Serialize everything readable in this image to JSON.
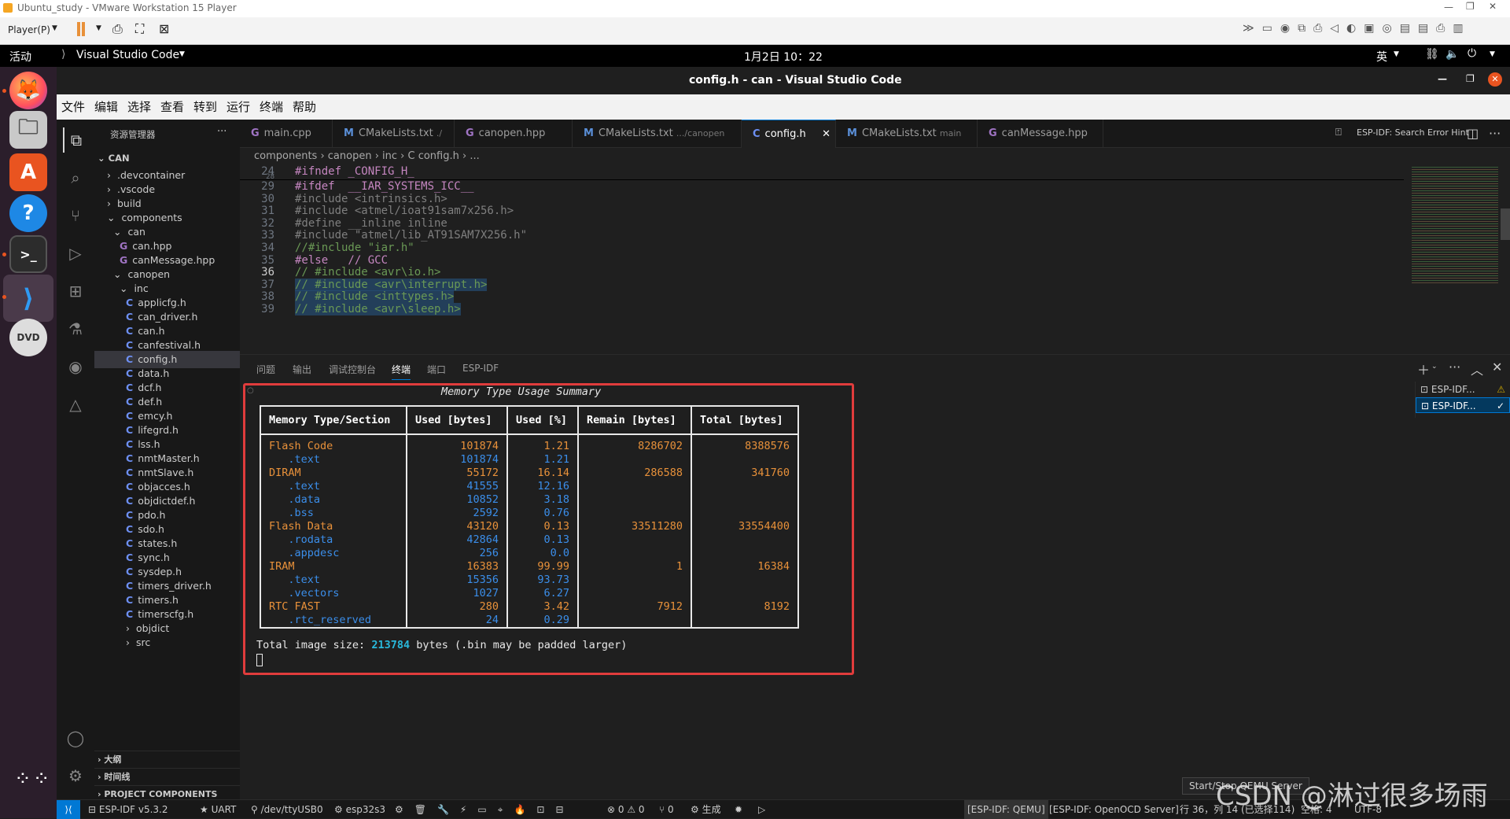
{
  "vm": {
    "title": "Ubuntu_study - VMware Workstation 15 Player",
    "player_menu": "Player(P)"
  },
  "ubuntu": {
    "activities": "活动",
    "app_menu": "Visual Studio Code",
    "clock": "1月2日  10：22",
    "input_method": "英"
  },
  "vscode": {
    "window_title": "config.h - can - Visual Studio Code",
    "menu": [
      "文件",
      "编辑",
      "选择",
      "查看",
      "转到",
      "运行",
      "终端",
      "帮助"
    ],
    "explorer_title": "资源管理器",
    "root": "CAN",
    "tree": [
      {
        "label": ".devcontainer",
        "type": "folder",
        "depth": 1,
        "open": false
      },
      {
        "label": ".vscode",
        "type": "folder",
        "depth": 1,
        "open": false
      },
      {
        "label": "build",
        "type": "folder",
        "depth": 1,
        "open": false
      },
      {
        "label": "components",
        "type": "folder",
        "depth": 1,
        "open": true
      },
      {
        "label": "can",
        "type": "folder",
        "depth": 2,
        "open": true
      },
      {
        "label": "can.hpp",
        "type": "cpp",
        "depth": 3
      },
      {
        "label": "canMessage.hpp",
        "type": "cpp",
        "depth": 3
      },
      {
        "label": "canopen",
        "type": "folder",
        "depth": 2,
        "open": true
      },
      {
        "label": "inc",
        "type": "folder",
        "depth": 3,
        "open": true
      },
      {
        "label": "applicfg.h",
        "type": "c",
        "depth": 4
      },
      {
        "label": "can_driver.h",
        "type": "c",
        "depth": 4
      },
      {
        "label": "can.h",
        "type": "c",
        "depth": 4
      },
      {
        "label": "canfestival.h",
        "type": "c",
        "depth": 4
      },
      {
        "label": "config.h",
        "type": "c",
        "depth": 4,
        "selected": true
      },
      {
        "label": "data.h",
        "type": "c",
        "depth": 4
      },
      {
        "label": "dcf.h",
        "type": "c",
        "depth": 4
      },
      {
        "label": "def.h",
        "type": "c",
        "depth": 4
      },
      {
        "label": "emcy.h",
        "type": "c",
        "depth": 4
      },
      {
        "label": "lifegrd.h",
        "type": "c",
        "depth": 4
      },
      {
        "label": "lss.h",
        "type": "c",
        "depth": 4
      },
      {
        "label": "nmtMaster.h",
        "type": "c",
        "depth": 4
      },
      {
        "label": "nmtSlave.h",
        "type": "c",
        "depth": 4
      },
      {
        "label": "objacces.h",
        "type": "c",
        "depth": 4
      },
      {
        "label": "objdictdef.h",
        "type": "c",
        "depth": 4
      },
      {
        "label": "pdo.h",
        "type": "c",
        "depth": 4
      },
      {
        "label": "sdo.h",
        "type": "c",
        "depth": 4
      },
      {
        "label": "states.h",
        "type": "c",
        "depth": 4
      },
      {
        "label": "sync.h",
        "type": "c",
        "depth": 4
      },
      {
        "label": "sysdep.h",
        "type": "c",
        "depth": 4
      },
      {
        "label": "timers_driver.h",
        "type": "c",
        "depth": 4
      },
      {
        "label": "timers.h",
        "type": "c",
        "depth": 4
      },
      {
        "label": "timerscfg.h",
        "type": "c",
        "depth": 4
      },
      {
        "label": "objdict",
        "type": "folder",
        "depth": 4,
        "open": false
      },
      {
        "label": "src",
        "type": "folder",
        "depth": 4,
        "open": false
      }
    ],
    "sections": [
      "大纲",
      "时间线",
      "PROJECT COMPONENTS"
    ],
    "tabs": [
      {
        "icon": "G",
        "label": "main.cpp",
        "hint": ""
      },
      {
        "icon": "M",
        "label": "CMakeLists.txt",
        "hint": "./"
      },
      {
        "icon": "G",
        "label": "canopen.hpp",
        "hint": ""
      },
      {
        "icon": "M",
        "label": "CMakeLists.txt",
        "hint": ".../canopen"
      },
      {
        "icon": "C",
        "label": "config.h",
        "hint": "",
        "active": true
      },
      {
        "icon": "M",
        "label": "CMakeLists.txt",
        "hint": "main"
      },
      {
        "icon": "G",
        "label": "canMessage.hpp",
        "hint": ""
      }
    ],
    "tab_right": "ESP-IDF: Search Error Hint",
    "breadcrumb": "components › canopen › inc › C config.h › ...",
    "code_lines": [
      {
        "n": "24",
        "t": "#ifndef _CONFIG_H_"
      },
      {
        "n": "28",
        "t": ""
      },
      {
        "n": "29",
        "t": "#ifdef  __IAR_SYSTEMS_ICC__"
      },
      {
        "n": "30",
        "t": "#include <intrinsics.h>"
      },
      {
        "n": "31",
        "t": "#include <atmel/ioat91sam7x256.h>"
      },
      {
        "n": "32",
        "t": "#define __inline inline"
      },
      {
        "n": "33",
        "t": "#include \"atmel/lib_AT91SAM7X256.h\""
      },
      {
        "n": "34",
        "t": "//#include \"iar.h\""
      },
      {
        "n": "35",
        "t": "#else   // GCC"
      },
      {
        "n": "36",
        "t": "// #include <avr\\io.h>"
      },
      {
        "n": "37",
        "t": "// #include <avr\\interrupt.h>"
      },
      {
        "n": "38",
        "t": "// #include <inttypes.h>"
      },
      {
        "n": "39",
        "t": "// #include <avr\\sleep.h>"
      }
    ],
    "panel_tabs": [
      "问题",
      "输出",
      "调试控制台",
      "终端",
      "端口",
      "ESP-IDF"
    ],
    "terminals": [
      "ESP-IDF...",
      "ESP-IDF..."
    ],
    "tooltip": "Start/Stop QEMU Server"
  },
  "terminal": {
    "title": "Memory Type Usage Summary",
    "headers": [
      "Memory Type/Section",
      "Used [bytes]",
      "Used [%]",
      "Remain [bytes]",
      "Total [bytes]"
    ],
    "rows": [
      {
        "name": "Flash Code",
        "used": "101874",
        "pct": "1.21",
        "remain": "8286702",
        "total": "8388576",
        "main": true
      },
      {
        "name": "   .text",
        "used": "101874",
        "pct": "1.21",
        "remain": "",
        "total": "",
        "main": false
      },
      {
        "name": "DIRAM",
        "used": "55172",
        "pct": "16.14",
        "remain": "286588",
        "total": "341760",
        "main": true
      },
      {
        "name": "   .text",
        "used": "41555",
        "pct": "12.16",
        "remain": "",
        "total": "",
        "main": false
      },
      {
        "name": "   .data",
        "used": "10852",
        "pct": "3.18",
        "remain": "",
        "total": "",
        "main": false
      },
      {
        "name": "   .bss",
        "used": "2592",
        "pct": "0.76",
        "remain": "",
        "total": "",
        "main": false
      },
      {
        "name": "Flash Data",
        "used": "43120",
        "pct": "0.13",
        "remain": "33511280",
        "total": "33554400",
        "main": true
      },
      {
        "name": "   .rodata",
        "used": "42864",
        "pct": "0.13",
        "remain": "",
        "total": "",
        "main": false
      },
      {
        "name": "   .appdesc",
        "used": "256",
        "pct": "0.0",
        "remain": "",
        "total": "",
        "main": false
      },
      {
        "name": "IRAM",
        "used": "16383",
        "pct": "99.99",
        "remain": "1",
        "total": "16384",
        "main": true
      },
      {
        "name": "   .text",
        "used": "15356",
        "pct": "93.73",
        "remain": "",
        "total": "",
        "main": false
      },
      {
        "name": "   .vectors",
        "used": "1027",
        "pct": "6.27",
        "remain": "",
        "total": "",
        "main": false
      },
      {
        "name": "RTC FAST",
        "used": "280",
        "pct": "3.42",
        "remain": "7912",
        "total": "8192",
        "main": true
      },
      {
        "name": "   .rtc_reserved",
        "used": "24",
        "pct": "0.29",
        "remain": "",
        "total": "",
        "main": false
      }
    ],
    "total_prefix": "Total image size: ",
    "total_value": "213784",
    "total_suffix": " bytes (.bin may be padded larger)"
  },
  "status": {
    "idf_version": "ESP-IDF v5.3.2",
    "uart": "UART",
    "port": "/dev/ttyUSB0",
    "target": "esp32s3",
    "problems": "0 ⚠ 0",
    "ports": "0",
    "build": "生成",
    "qemu": "[ESP-IDF: QEMU]",
    "openocd": "[ESP-IDF: OpenOCD Server]",
    "cursor": "行 36，列 14 (已选择114)",
    "spaces": "空格: 4",
    "encoding": "UTF-8"
  },
  "watermark": "CSDN @淋过很多场雨",
  "colors": {
    "orange": "#e8913a",
    "blue": "#3b8eea",
    "accent": "#007acc",
    "highlight": "#e03c3c"
  }
}
